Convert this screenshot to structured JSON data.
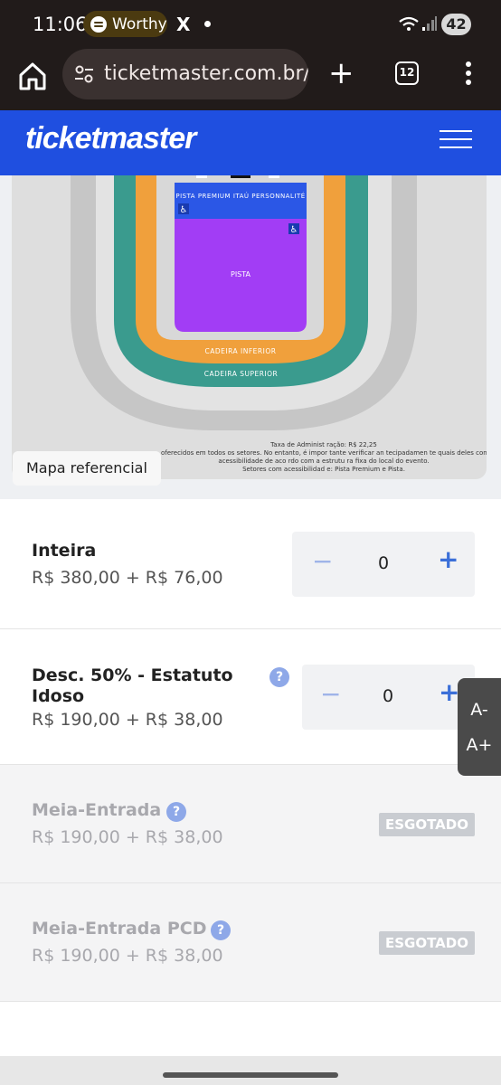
{
  "status_bar": {
    "time": "11:06",
    "now_playing": "Worthy",
    "x_icon": "X",
    "battery": "42"
  },
  "browser": {
    "url": "ticketmaster.com.br/ev",
    "tab_count": "12"
  },
  "header": {
    "logo": "ticketmaster"
  },
  "map": {
    "sections": {
      "premium": "PISTA PREMIUM ITAÚ PERSONNALITÉ",
      "pista": "PISTA",
      "inferior": "CADEIRA INFERIOR",
      "superior": "CADEIRA SUPERIOR"
    },
    "notes": [
      "Taxa de Administ ração: R$ 22,25",
      "oferecidos em todos os setores. No entanto, é impor tante verificar an tecipadamen te quais deles con tam",
      "acessibilidade de aco  rdo com a estrutu ra fixa do local do   evento.",
      "Setores com acessibilidad e: Pista Premium e Pista."
    ],
    "label": "Mapa referencial"
  },
  "tickets": [
    {
      "name": "Inteira",
      "price": "R$ 380,00 + R$ 76,00",
      "qty": "0",
      "minus": "−",
      "plus": "+"
    },
    {
      "name_line1": "Desc. 50% - Estatuto",
      "name_line2": "Idoso",
      "price": "R$ 190,00 + R$ 38,00",
      "qty": "0",
      "minus": "−",
      "plus": "+",
      "help": "?"
    },
    {
      "name": "Meia-Entrada",
      "price": "R$ 190,00 + R$ 38,00",
      "status": "ESGOTADO",
      "help": "?"
    },
    {
      "name": "Meia-Entrada PCD",
      "price": "R$ 190,00 + R$ 38,00",
      "status": "ESGOTADO",
      "help": "?"
    }
  ],
  "font_controls": {
    "decrease": "A-",
    "increase": "A+"
  },
  "colors": {
    "brand_blue": "#1f4fe0",
    "pista_purple": "#a23df5",
    "premium_blue": "#2b57e6",
    "cadeira_inferior_orange": "#f0a03c",
    "cadeira_superior_teal": "#3a9b8e"
  }
}
